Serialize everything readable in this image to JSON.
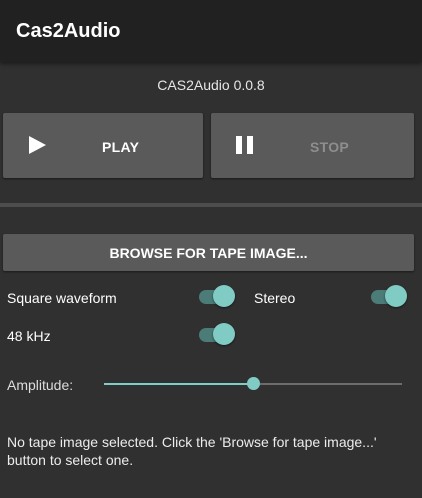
{
  "app": {
    "title": "Cas2Audio",
    "version": "CAS2Audio 0.0.8"
  },
  "transport": {
    "play_label": "PLAY",
    "stop_label": "STOP"
  },
  "browse": {
    "label": "BROWSE FOR TAPE IMAGE..."
  },
  "options": {
    "square_waveform": {
      "label": "Square waveform",
      "on": true
    },
    "stereo": {
      "label": "Stereo",
      "on": true
    },
    "rate_48khz": {
      "label": "48 kHz",
      "on": true
    }
  },
  "amplitude": {
    "label": "Amplitude:",
    "value": 0.5
  },
  "status": "No tape image selected. Click the 'Browse for tape image...' button to select one.",
  "colors": {
    "accent": "#80cbc4",
    "background": "#303030",
    "appbar": "#212121",
    "button": "#5a5a5a"
  },
  "icons": {
    "play": "play-icon",
    "stop": "pause-icon"
  }
}
